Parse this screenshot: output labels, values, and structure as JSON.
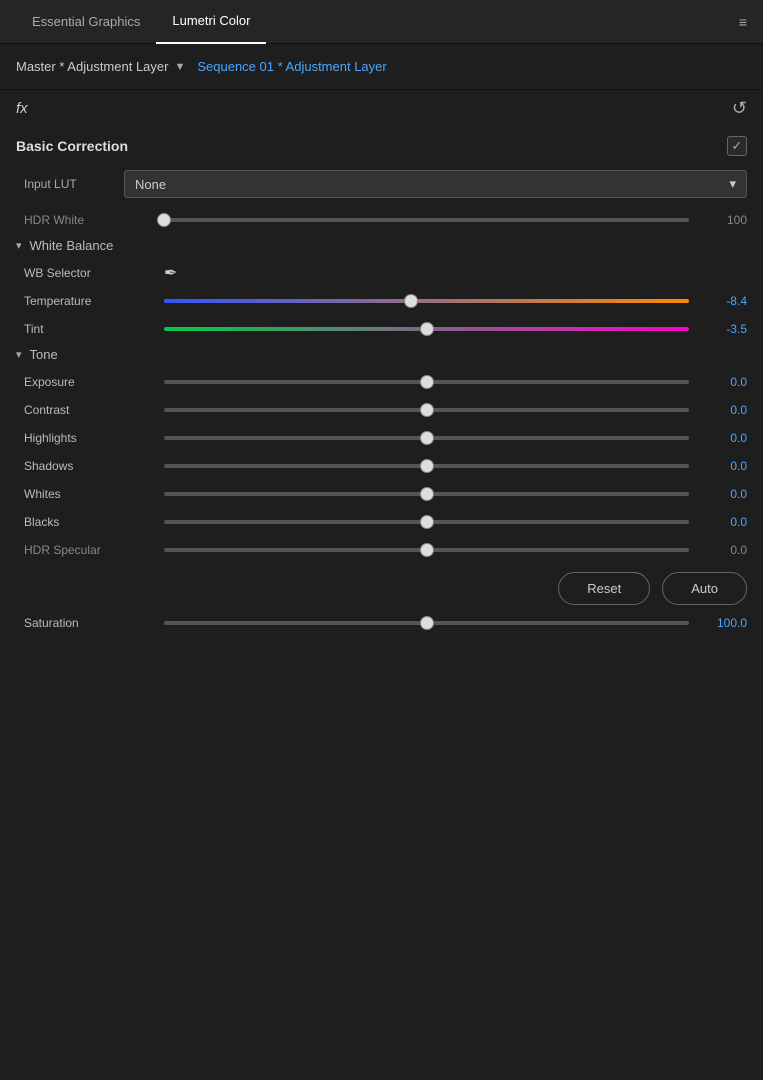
{
  "tabs": {
    "essential_graphics": "Essential Graphics",
    "lumetri_color": "Lumetri Color",
    "active": "lumetri_color",
    "menu_icon": "≡"
  },
  "header": {
    "layer_name": "Master * Adjustment Layer",
    "chevron": "▼",
    "sequence_label": "Sequence 01 * Adjustment Layer"
  },
  "fx": {
    "label": "fx",
    "reset_icon": "↺"
  },
  "basic_correction": {
    "title": "Basic Correction",
    "input_lut": {
      "label": "Input LUT",
      "value": "None",
      "chevron": "▾"
    },
    "hdr_white": {
      "label": "HDR White",
      "value": "100",
      "thumb_pos": "0"
    },
    "white_balance": {
      "title": "White Balance",
      "wb_selector": {
        "label": "WB Selector"
      },
      "temperature": {
        "label": "Temperature",
        "value": "-8.4",
        "thumb_pos": "47"
      },
      "tint": {
        "label": "Tint",
        "value": "-3.5",
        "thumb_pos": "50"
      }
    },
    "tone": {
      "title": "Tone",
      "exposure": {
        "label": "Exposure",
        "value": "0.0",
        "thumb_pos": "50"
      },
      "contrast": {
        "label": "Contrast",
        "value": "0.0",
        "thumb_pos": "50"
      },
      "highlights": {
        "label": "Highlights",
        "value": "0.0",
        "thumb_pos": "50"
      },
      "shadows": {
        "label": "Shadows",
        "value": "0.0",
        "thumb_pos": "50"
      },
      "whites": {
        "label": "Whites",
        "value": "0.0",
        "thumb_pos": "50"
      },
      "blacks": {
        "label": "Blacks",
        "value": "0.0",
        "thumb_pos": "50"
      },
      "hdr_specular": {
        "label": "HDR Specular",
        "value": "0.0",
        "thumb_pos": "50"
      }
    },
    "buttons": {
      "reset": "Reset",
      "auto": "Auto"
    },
    "saturation": {
      "label": "Saturation",
      "value": "100.0",
      "thumb_pos": "50"
    }
  }
}
